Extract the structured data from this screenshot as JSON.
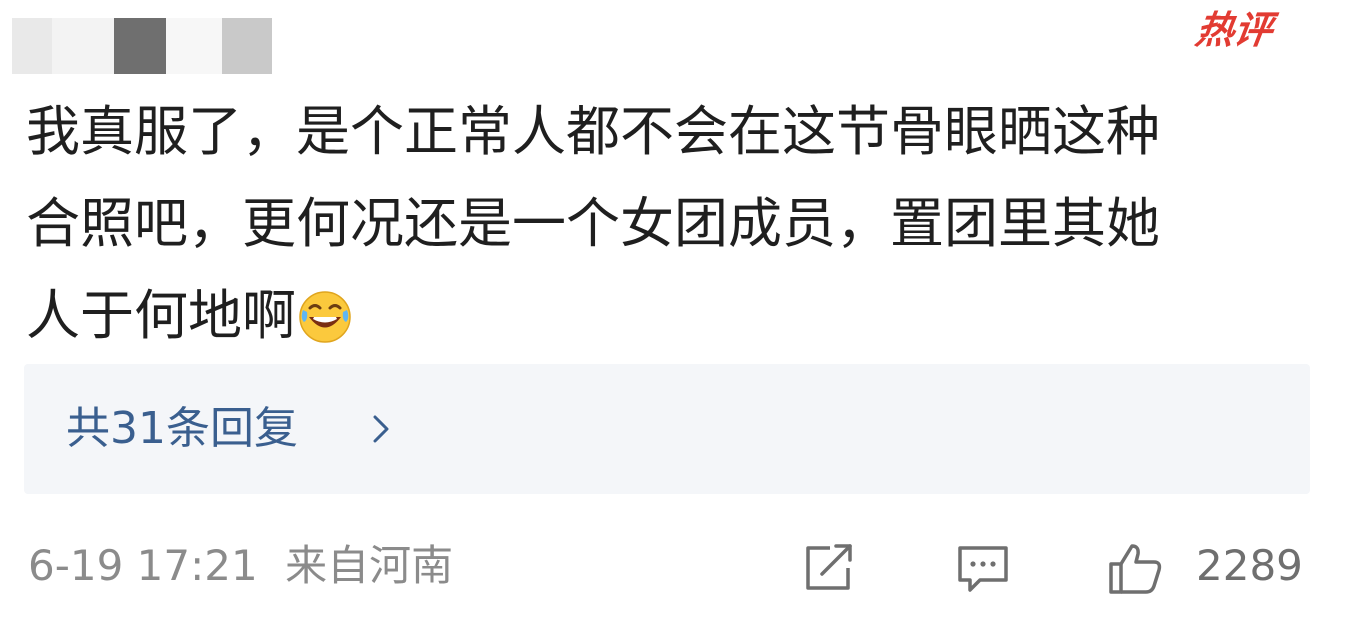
{
  "header": {
    "username_mosaic_colors": [
      "#e9e9e9",
      "#f3f3f3",
      "#6f6f6f",
      "#f7f7f7",
      "#c9c9c9",
      "#efefef"
    ],
    "hot_badge": "热评",
    "hot_badge_color": "#e23b32"
  },
  "comment": {
    "line1": "我真服了，是个正常人都不会在这节骨眼晒这种",
    "line2": "合照吧，更何况还是一个女团成员，置团里其她",
    "line3": "人于何地啊",
    "emoji": "laughing-crying-emoji"
  },
  "replies": {
    "label": "共31条回复",
    "background": "#f4f6f9",
    "link_color": "#3a5f8f"
  },
  "footer": {
    "date": "6-19 17:21",
    "location": "来自河南",
    "icons": [
      "share-icon",
      "comment-icon",
      "like-icon"
    ],
    "like_count": "2289"
  }
}
